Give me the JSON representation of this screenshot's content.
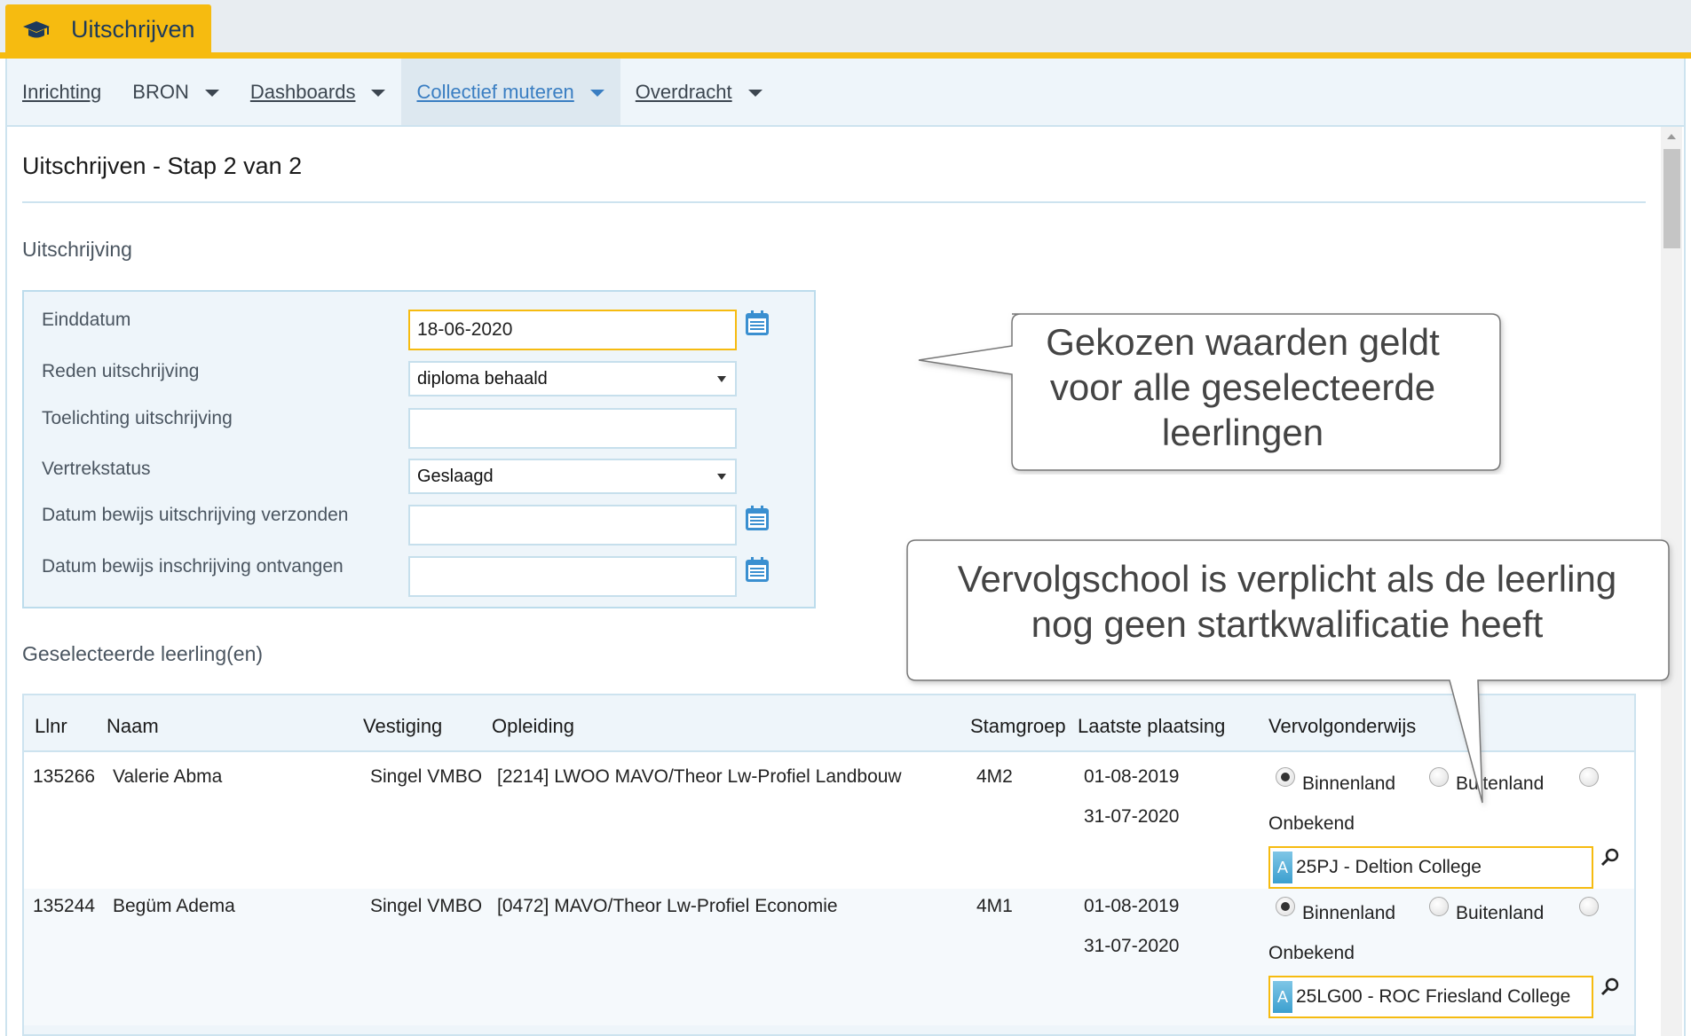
{
  "app": {
    "title": "Uitschrijven",
    "icon": "graduation-cap-icon"
  },
  "nav": {
    "items": [
      {
        "label": "Inrichting",
        "has_menu": false
      },
      {
        "label": "BRON",
        "has_menu": true
      },
      {
        "label": "Dashboards",
        "has_menu": true
      },
      {
        "label": "Collectief muteren",
        "has_menu": true,
        "active": true
      },
      {
        "label": "Overdracht",
        "has_menu": true
      }
    ]
  },
  "page": {
    "title": "Uitschrijven - Stap 2 van 2",
    "section_title": "Uitschrijving",
    "students_title": "Geselecteerde leerling(en)"
  },
  "form": {
    "einddatum": {
      "label": "Einddatum",
      "value": "18-06-2020"
    },
    "reden": {
      "label": "Reden uitschrijving",
      "value": "diploma behaald"
    },
    "toelichting": {
      "label": "Toelichting uitschrijving",
      "value": ""
    },
    "vertrekstatus": {
      "label": "Vertrekstatus",
      "value": "Geslaagd"
    },
    "bewijs_verzonden": {
      "label": "Datum bewijs uitschrijving verzonden",
      "value": ""
    },
    "bewijs_ontvangen": {
      "label": "Datum bewijs inschrijving ontvangen",
      "value": ""
    }
  },
  "callouts": {
    "first": [
      "Gekozen waarden geldt",
      "voor alle geselecteerde",
      "leerlingen"
    ],
    "second": [
      "Vervolgschool is verplicht als de leerling",
      "nog geen startkwalificatie heeft"
    ]
  },
  "table": {
    "headers": [
      "Llnr",
      "Naam",
      "Vestiging",
      "Opleiding",
      "Stamgroep",
      "Laatste plaatsing",
      "Vervolgonderwijs"
    ],
    "options": [
      "Binnenland",
      "Buitenland",
      "Onbekend"
    ],
    "rows": [
      {
        "llnr": "135266",
        "naam": "Valerie Abma",
        "vestiging": "Singel VMBO",
        "opleiding": "[2214] LWOO MAVO/Theor Lw-Profiel Landbouw",
        "stamgroep": "4M2",
        "plaatsing_start": "01-08-2019",
        "plaatsing_eind": "31-07-2020",
        "selected_option": "Binnenland",
        "school_badge": "A",
        "school": "25PJ - Deltion College"
      },
      {
        "llnr": "135244",
        "naam": "Begüm Adema",
        "vestiging": "Singel VMBO",
        "opleiding": "[0472] MAVO/Theor Lw-Profiel Economie",
        "stamgroep": "4M1",
        "plaatsing_start": "01-08-2019",
        "plaatsing_eind": "31-07-2020",
        "selected_option": "Binnenland",
        "school_badge": "A",
        "school": "25LG00 - ROC Friesland College"
      }
    ]
  },
  "colors": {
    "accent": "#f6bb10",
    "link": "#3a7ec2",
    "panel": "#eef5fa",
    "border": "#cde3ef"
  }
}
